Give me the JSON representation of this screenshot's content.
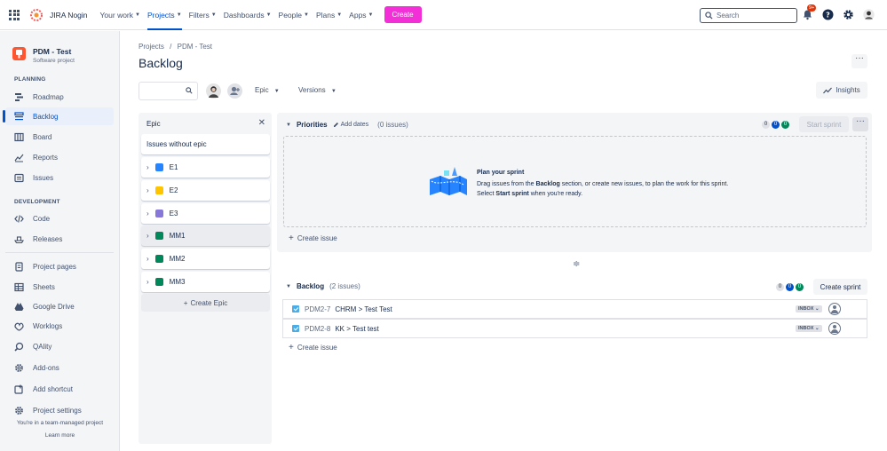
{
  "topbar": {
    "app_name": "JIRA Nogin",
    "nav": [
      {
        "label": "Your work"
      },
      {
        "label": "Projects"
      },
      {
        "label": "Filters"
      },
      {
        "label": "Dashboards"
      },
      {
        "label": "People"
      },
      {
        "label": "Plans"
      },
      {
        "label": "Apps"
      }
    ],
    "create_label": "Create",
    "search_placeholder": "Search",
    "notification_badge": "9+",
    "colors": {
      "create": "#f32fd7",
      "active_nav": "#0052cc"
    }
  },
  "sidebar": {
    "project_name": "PDM - Test",
    "project_type": "Software project",
    "planning_label": "PLANNING",
    "development_label": "DEVELOPMENT",
    "items": {
      "roadmap": "Roadmap",
      "backlog": "Backlog",
      "board": "Board",
      "reports": "Reports",
      "issues": "Issues",
      "code": "Code",
      "releases": "Releases",
      "project_pages": "Project pages",
      "sheets": "Sheets",
      "google_drive": "Google Drive",
      "worklogs": "Worklogs",
      "qality": "QAlity",
      "addons": "Add-ons",
      "add_shortcut": "Add shortcut",
      "project_settings": "Project settings"
    },
    "footer_text": "You're in a team-managed project",
    "learn_more": "Learn more"
  },
  "main": {
    "breadcrumb_projects": "Projects",
    "breadcrumb_sep": "/",
    "breadcrumb_project": "PDM - Test",
    "title": "Backlog",
    "epic_filter": "Epic",
    "versions_filter": "Versions",
    "insights": "Insights"
  },
  "epic_panel": {
    "title": "Epic",
    "without_epic": "Issues without epic",
    "epics": [
      {
        "name": "E1",
        "color": "#2684ff"
      },
      {
        "name": "E2",
        "color": "#ffc400"
      },
      {
        "name": "E3",
        "color": "#8777d9"
      },
      {
        "name": "MM1",
        "color": "#00875a"
      },
      {
        "name": "MM2",
        "color": "#00875a"
      },
      {
        "name": "MM3",
        "color": "#00875a"
      }
    ],
    "create_epic": "Create Epic"
  },
  "sprint": {
    "name": "Priorities",
    "add_dates": "Add dates",
    "issue_count": "(0 issues)",
    "counts": [
      "0",
      "0",
      "0"
    ],
    "start_sprint": "Start sprint",
    "plan_title": "Plan your sprint",
    "plan_text_1": "Drag issues from the ",
    "plan_text_bold_1": "Backlog",
    "plan_text_2": " section, or create new issues, to plan the work for this sprint. Select ",
    "plan_text_bold_2": "Start sprint",
    "plan_text_3": " when you're ready.",
    "create_issue": "Create issue"
  },
  "backlog": {
    "name": "Backlog",
    "issue_count": "(2 issues)",
    "counts": [
      "0",
      "0",
      "0"
    ],
    "create_sprint": "Create sprint",
    "issues": [
      {
        "key": "PDM2-7",
        "summary": "CHRM > Test Test",
        "status": "INBOX"
      },
      {
        "key": "PDM2-8",
        "summary": "KK > Test test",
        "status": "INBOX"
      }
    ],
    "create_issue": "Create issue"
  }
}
